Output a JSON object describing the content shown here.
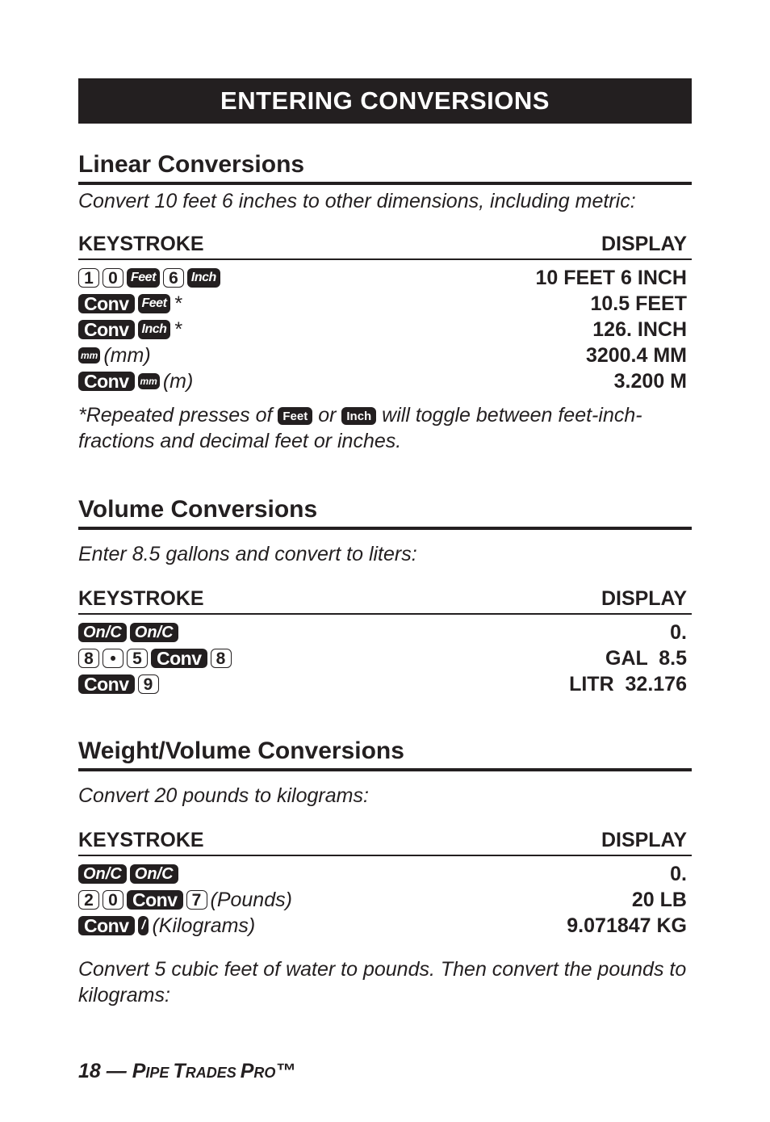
{
  "banner": {
    "title": "ENTERING CONVERSIONS"
  },
  "columns": {
    "keystroke": "KEYSTROKE",
    "display": "DISPLAY"
  },
  "linear": {
    "title": "Linear Conversions",
    "intro": "Convert 10 feet 6 inches to other dimensions, including metric:",
    "rows": [
      {
        "keys": [
          "1",
          "0",
          "Feet",
          "6",
          "Inch"
        ],
        "label": "",
        "display": "10 FEET 6 INCH"
      },
      {
        "keys": [
          "Conv",
          "Feet"
        ],
        "label": "*",
        "display": "10.5 FEET"
      },
      {
        "keys": [
          "Conv",
          "Inch"
        ],
        "label": "*",
        "display": "126. INCH"
      },
      {
        "keys": [
          "mm"
        ],
        "label": "(mm)",
        "display": "3200.4 MM"
      },
      {
        "keys": [
          "Conv",
          "mm"
        ],
        "label": "(m)",
        "display": "3.200 M"
      }
    ],
    "note": {
      "part1": "*Repeated presses of",
      "key1": "Feet",
      "part2": "or",
      "key2": "Inch",
      "part3": "will toggle between feet-inch-fractions and decimal feet or inches."
    }
  },
  "volume": {
    "title": "Volume Conversions",
    "intro": "Enter 8.5 gallons and convert to liters:",
    "rows": [
      {
        "keys": [
          "On/C",
          "On/C"
        ],
        "label": "",
        "display": "0."
      },
      {
        "keys": [
          "8",
          "•",
          "5",
          "Conv",
          "8"
        ],
        "label": "",
        "display": "GAL  8.5"
      },
      {
        "keys": [
          "Conv",
          "9"
        ],
        "label": "",
        "display": "LITR  32.176"
      }
    ]
  },
  "weight": {
    "title": "Weight/Volume Conversions",
    "intro": "Convert 20 pounds to kilograms:",
    "rows": [
      {
        "keys": [
          "On/C",
          "On/C"
        ],
        "label": "",
        "display": "0."
      },
      {
        "keys": [
          "2",
          "0",
          "Conv",
          "7"
        ],
        "label": "(Pounds)",
        "display": "20 LB"
      },
      {
        "keys": [
          "Conv",
          "/"
        ],
        "label": "(Kilograms)",
        "display": "9.071847 KG"
      }
    ],
    "outro": "Convert 5 cubic feet of water to pounds. Then convert the pounds to kilograms:"
  },
  "footer": {
    "page": "18",
    "dash": "—",
    "product_p1": "P",
    "product_p2": "IPE ",
    "product_t1": "T",
    "product_t2": "RADES ",
    "product_r1": "P",
    "product_r2": "RO",
    "tm": "™"
  }
}
